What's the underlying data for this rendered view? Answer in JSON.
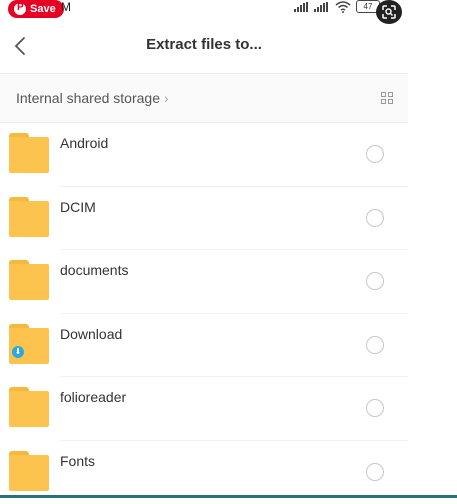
{
  "status_bar": {
    "save_label": "Save",
    "time_fragment": "M",
    "battery": "47"
  },
  "header": {
    "title": "Extract files to..."
  },
  "breadcrumb": {
    "label": "Internal shared storage",
    "chevron": "›"
  },
  "folders": [
    {
      "name": "Android",
      "badge": false
    },
    {
      "name": "DCIM",
      "badge": false
    },
    {
      "name": "documents",
      "badge": false
    },
    {
      "name": "Download",
      "badge": true
    },
    {
      "name": "folioreader",
      "badge": false
    },
    {
      "name": "Fonts",
      "badge": false
    }
  ],
  "colors": {
    "folder": "#fcc44f",
    "folder_tab": "#f6b93f",
    "download_badge": "#2ea7e0",
    "pinterest": "#e60023"
  },
  "icons": {
    "back": "chevron-left-icon",
    "view_toggle": "grid-view-icon",
    "lens": "visual-search-icon"
  }
}
